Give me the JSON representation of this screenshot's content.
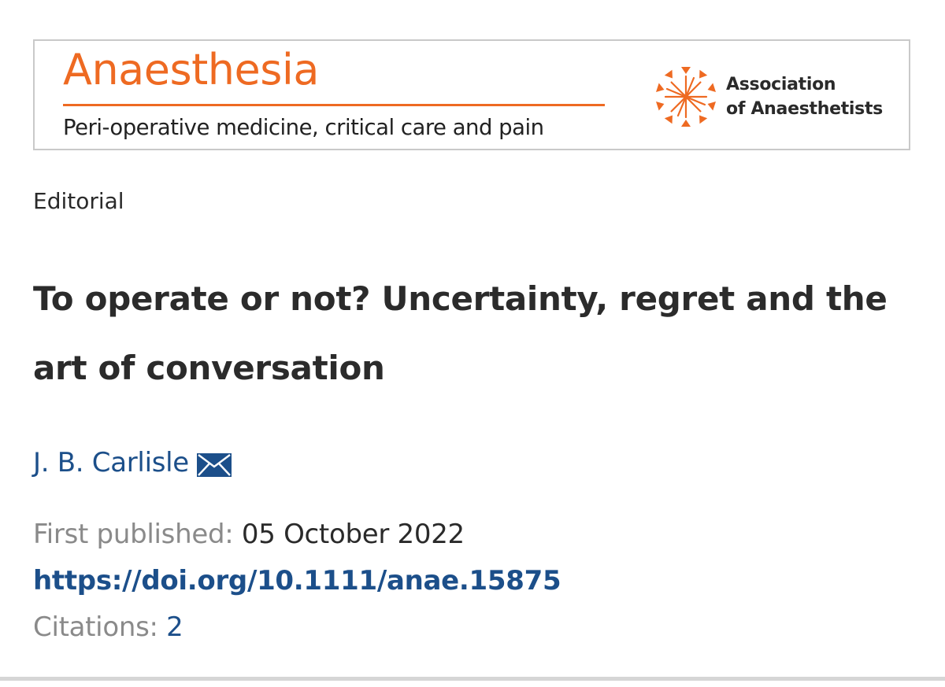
{
  "banner": {
    "journal_name": "Anaesthesia",
    "tagline": "Peri-operative medicine, critical care and pain",
    "association_line1": "Association",
    "association_line2": "of Anaesthetists",
    "brand_color": "#ee6a22",
    "logo_icon": "association-starburst-icon"
  },
  "article": {
    "type": "Editorial",
    "title": "To operate or not? Uncertainty, regret and the art of conversation",
    "author": "J. B. Carlisle",
    "author_contact_icon": "mail-icon",
    "first_published_label": "First published:",
    "first_published_value": "05 October 2022",
    "doi": "https://doi.org/10.1111/anae.15875",
    "citations_label": "Citations:",
    "citations_value": "2",
    "link_color": "#1c4f8a"
  }
}
